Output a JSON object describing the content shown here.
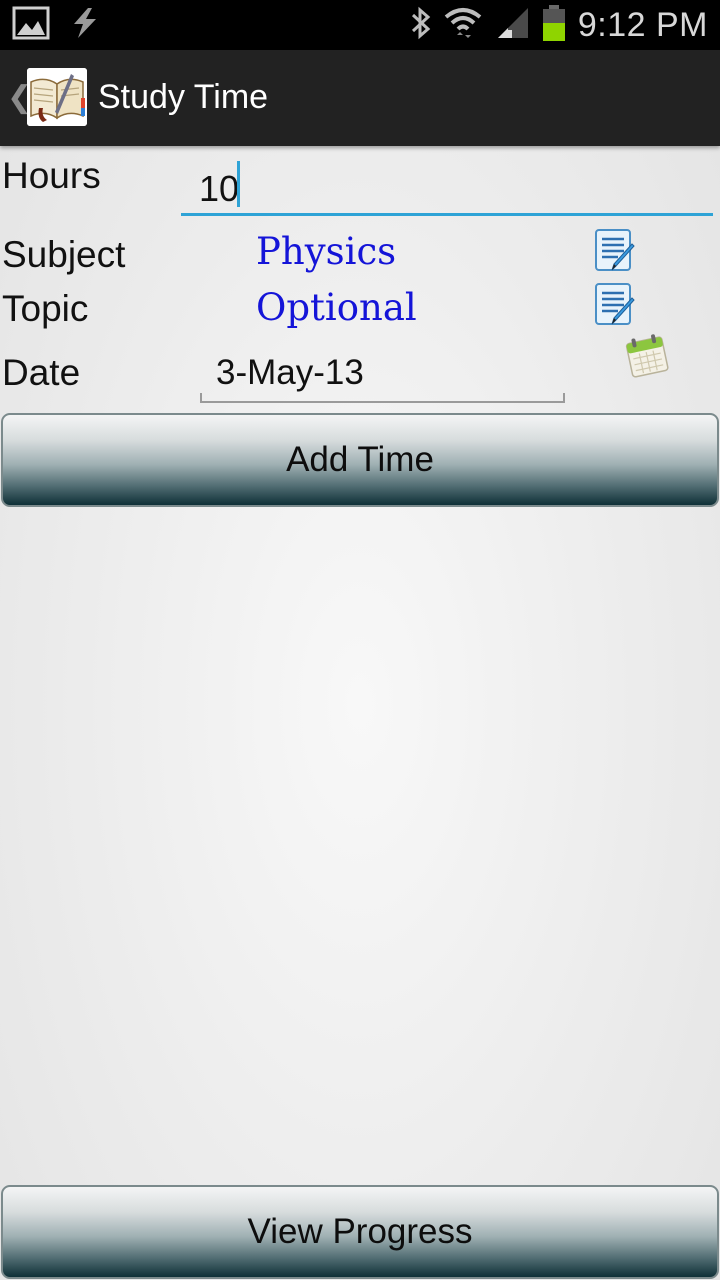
{
  "status_bar": {
    "time": "9:12 PM",
    "icons": [
      "gallery-icon",
      "flash-icon",
      "bluetooth-icon",
      "wifi-icon",
      "signal-icon",
      "battery-icon"
    ],
    "battery_color": "#8fd400"
  },
  "action_bar": {
    "title": "Study Time",
    "app_icon": "book-icon"
  },
  "form": {
    "hours_label": "Hours",
    "hours_value": "10",
    "subject_label": "Subject",
    "subject_value": "Physics",
    "topic_label": "Topic",
    "topic_value": "Optional",
    "date_label": "Date",
    "date_value": "3-May-13",
    "link_color": "#1414d8",
    "accent_color": "#2ea3d6"
  },
  "buttons": {
    "add_time": "Add Time",
    "view_progress": "View Progress"
  }
}
